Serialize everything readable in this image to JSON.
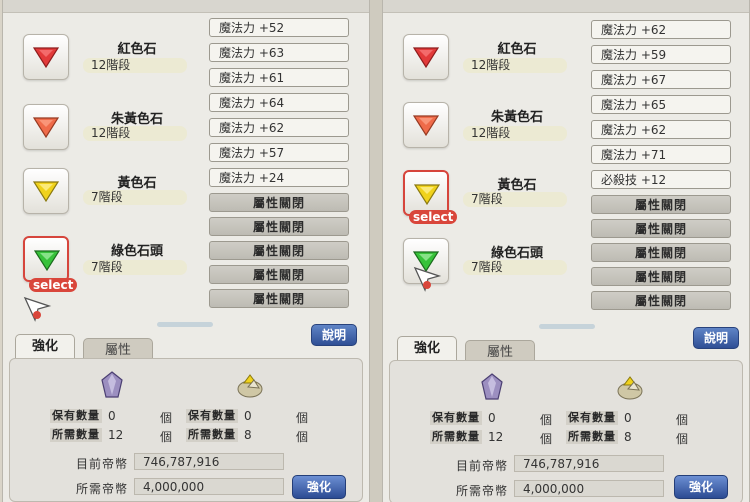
{
  "colors": {
    "red_gem": "#e23a3a",
    "orange_gem": "#ef6b4a",
    "yellow_gem": "#f0d21c",
    "green_gem": "#37c23a",
    "select_tag": "#d9463b",
    "button_blue": "#35539b"
  },
  "left": {
    "gems": [
      {
        "name": "紅色石",
        "level": "12階段",
        "icon": "red-gem-icon"
      },
      {
        "name": "朱黃色石",
        "level": "12階段",
        "icon": "orange-gem-icon"
      },
      {
        "name": "黃色石",
        "level": "7階段",
        "icon": "yellow-gem-icon"
      },
      {
        "name": "綠色石頭",
        "level": "7階段",
        "icon": "green-gem-icon",
        "selected": true
      }
    ],
    "select_label": "select",
    "attributes": [
      "魔法力 +52",
      "魔法力 +63",
      "魔法力 +61",
      "魔法力 +64",
      "魔法力 +62",
      "魔法力 +57",
      "魔法力 +24",
      "屬性關閉",
      "屬性關閉",
      "屬性關閉",
      "屬性關閉",
      "屬性關閉"
    ],
    "help_label": "說明",
    "tabs": [
      "強化",
      "屬性"
    ],
    "held_label": "保有數量",
    "need_label": "所需數量",
    "unit": "個",
    "mat1": {
      "held": "0",
      "need": "12"
    },
    "mat2": {
      "held": "0",
      "need": "8"
    },
    "current_money_label": "目前帝幣",
    "current_money": "746,787,916",
    "need_money_label": "所需帝幣",
    "need_money": "4,000,000",
    "enhance_label": "強化"
  },
  "right": {
    "gems": [
      {
        "name": "紅色石",
        "level": "12階段",
        "icon": "red-gem-icon"
      },
      {
        "name": "朱黃色石",
        "level": "12階段",
        "icon": "orange-gem-icon"
      },
      {
        "name": "黃色石",
        "level": "7階段",
        "icon": "yellow-gem-icon",
        "selected": true
      },
      {
        "name": "綠色石頭",
        "level": "7階段",
        "icon": "green-gem-icon"
      }
    ],
    "select_label": "select",
    "attributes": [
      "魔法力 +62",
      "魔法力 +59",
      "魔法力 +67",
      "魔法力 +65",
      "魔法力 +62",
      "魔法力 +71",
      "必殺技 +12",
      "屬性關閉",
      "屬性關閉",
      "屬性關閉",
      "屬性關閉",
      "屬性關閉"
    ],
    "help_label": "說明",
    "tabs": [
      "強化",
      "屬性"
    ],
    "held_label": "保有數量",
    "need_label": "所需數量",
    "unit": "個",
    "mat1": {
      "held": "0",
      "need": "12"
    },
    "mat2": {
      "held": "0",
      "need": "8"
    },
    "current_money_label": "目前帝幣",
    "current_money": "746,787,916",
    "need_money_label": "所需帝幣",
    "need_money": "4,000,000",
    "enhance_label": "強化"
  }
}
